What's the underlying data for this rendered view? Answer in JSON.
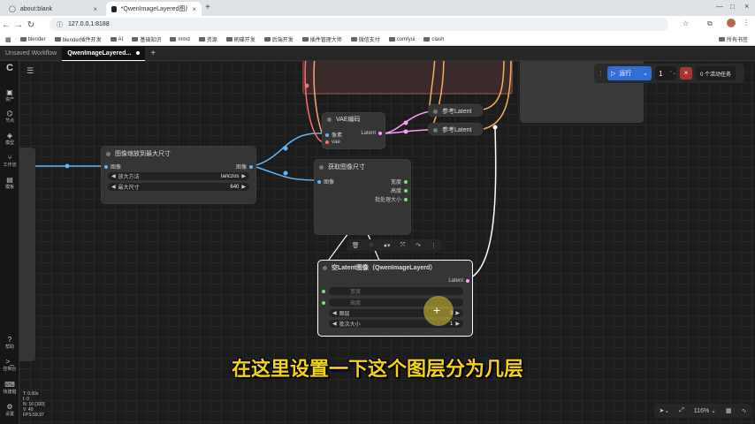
{
  "browser": {
    "tabs": [
      {
        "label": "about:blank"
      },
      {
        "label": "*QwenImageLayered图片分图"
      }
    ],
    "url": "127.0.0.1:8188",
    "bookmarks": [
      "blender",
      "blender插件开发",
      "AI",
      "基础知识",
      "mmd",
      "资源",
      "刷碟开发",
      "后端开发",
      "插件管理大师",
      "微信支付",
      "comfyui",
      "clash"
    ],
    "all_bookmarks": "所有书签"
  },
  "comfy": {
    "tabs": [
      {
        "label": "Unsaved Workflow"
      },
      {
        "label": "QwenImageLayered..."
      }
    ],
    "sidebar": [
      {
        "label": "资产",
        "icon": "image-icon"
      },
      {
        "label": "节点",
        "icon": "node-icon"
      },
      {
        "label": "模型",
        "icon": "model-icon"
      },
      {
        "label": "工作流",
        "icon": "workflow-icon"
      },
      {
        "label": "模板",
        "icon": "template-icon"
      },
      {
        "label": "帮助",
        "icon": "help-icon"
      },
      {
        "label": "控制台",
        "icon": "terminal-icon"
      },
      {
        "label": "快捷键",
        "icon": "keyboard-icon"
      },
      {
        "label": "设置",
        "icon": "gear-icon"
      }
    ],
    "stats": [
      "T: 0.00s",
      "I: 0",
      "N: 16 [100]",
      "V: 40",
      "FPS:59.97"
    ],
    "run": {
      "label": "运行",
      "count": "1",
      "queue": "0 个活动任务"
    },
    "zoom": "116%"
  },
  "nodes": {
    "vae_encode": {
      "title": "VAE编码",
      "in1": "像素",
      "in2": "vae",
      "out": "Latent"
    },
    "ref_latent_1": {
      "title": "参考Latent"
    },
    "ref_latent_2": {
      "title": "参考Latent"
    },
    "image_scale": {
      "title": "图像缩放到最大尺寸",
      "in": "图像",
      "out": "图像",
      "w1_label": "放大方法",
      "w1_value": "lanczos",
      "w2_label": "最大尺寸",
      "w2_value": "640"
    },
    "get_size": {
      "title": "获取图像尺寸",
      "in": "图像",
      "out1": "宽度",
      "out2": "高度",
      "out3": "批处理大小"
    },
    "empty_latent": {
      "title": "空Latent图像（QwenImageLayerd）",
      "out": "Latent",
      "w1_label": "宽度",
      "w2_label": "高度",
      "w3_label": "图层",
      "w3_value": "3",
      "w4_label": "批次大小",
      "w4_value": "1"
    }
  },
  "subtitle": "在这里设置一下这个图层分为几层",
  "colors": {
    "accent": "#2f6fd6",
    "subtitle": "#f2d21b",
    "link_image": "#64b5f6",
    "link_latent": "#ff9cf9",
    "link_vae": "#ff6e6e"
  }
}
